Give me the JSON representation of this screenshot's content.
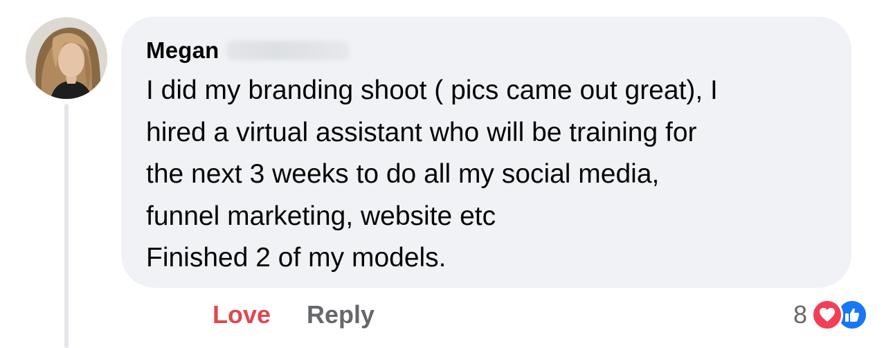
{
  "comment": {
    "author": {
      "first_name": "Megan",
      "surname_redacted": true,
      "avatar_icon": "profile-photo-avatar"
    },
    "lines": [
      "I did my branding shoot ( pics came out great), I",
      "hired a virtual assistant who will be training for",
      "the next 3 weeks to do all my social media,",
      "funnel marketing, website etc",
      "Finished 2 of my models."
    ],
    "actions": {
      "love_label": "Love",
      "reply_label": "Reply"
    },
    "reactions": {
      "count": "8",
      "types": [
        "heart-icon",
        "thumbs-up-icon"
      ]
    }
  },
  "colors": {
    "bubble_bg": "#f0f2f5",
    "love_active": "#e0474f",
    "secondary_text": "#65676b",
    "heart_reaction": "#f33e58",
    "like_reaction": "#1877f2"
  }
}
